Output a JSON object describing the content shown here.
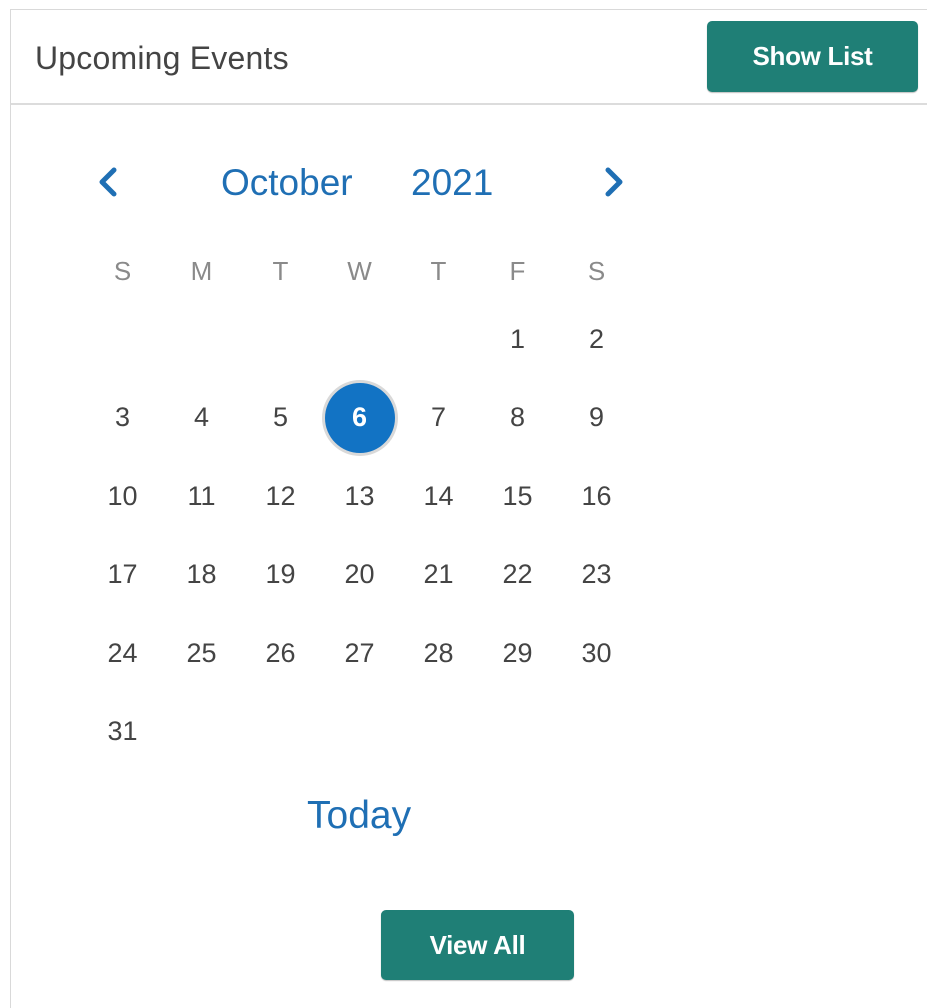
{
  "header": {
    "title": "Upcoming Events",
    "show_list_label": "Show List"
  },
  "calendar": {
    "month": "October",
    "year": "2021",
    "weekdays": [
      "S",
      "M",
      "T",
      "W",
      "T",
      "F",
      "S"
    ],
    "days": [
      "",
      "",
      "",
      "",
      "",
      "1",
      "2",
      "3",
      "4",
      "5",
      "6",
      "7",
      "8",
      "9",
      "10",
      "11",
      "12",
      "13",
      "14",
      "15",
      "16",
      "17",
      "18",
      "19",
      "20",
      "21",
      "22",
      "23",
      "24",
      "25",
      "26",
      "27",
      "28",
      "29",
      "30",
      "31"
    ],
    "selected_day": "6",
    "today_label": "Today"
  },
  "footer": {
    "view_all_label": "View All"
  },
  "colors": {
    "accent_teal": "#1f7f76",
    "link_blue": "#1f6fb4",
    "selected_blue": "#1273c4"
  },
  "icons": {
    "prev": "chevron-left-icon",
    "next": "chevron-right-icon"
  }
}
